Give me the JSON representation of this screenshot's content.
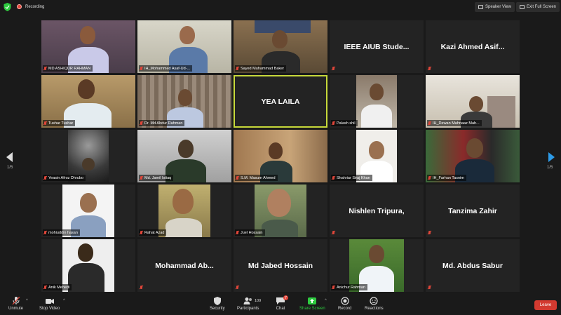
{
  "topbar": {
    "recording_label": "Recording",
    "speaker_view_label": "Speaker View",
    "exit_fullscreen_label": "Exit Full Screen"
  },
  "nav": {
    "left_page": "1/5",
    "right_page": "1/5"
  },
  "participants": [
    {
      "name": "MD ASHIQUR RAHMAN",
      "video": true
    },
    {
      "name": "IH_Mohammed Asaf-Ud-...",
      "video": true
    },
    {
      "name": "Sayed Muhammad Baker",
      "video": true
    },
    {
      "name": "IEEE AIUB Stude...",
      "video": false
    },
    {
      "name": "Kazi Ahmed Asif...",
      "video": false
    },
    {
      "name": "Tushar Tushar",
      "video": true
    },
    {
      "name": "Dr. Md Abdur Rahman",
      "video": true
    },
    {
      "name": "YEA LAILA",
      "video": false,
      "active": true
    },
    {
      "name": "Palash shil",
      "video": true
    },
    {
      "name": "IH_Dewan Mahnaaz Mah...",
      "video": true
    },
    {
      "name": "Yeasin Afroz Dhrubo",
      "video": true
    },
    {
      "name": "Md. Jamil Istiaq",
      "video": true
    },
    {
      "name": "S.M. Masum Ahmed",
      "video": true
    },
    {
      "name": "Shahriar Siraj Khan",
      "video": true
    },
    {
      "name": "IH_Farhan Tasnim",
      "video": true
    },
    {
      "name": "mohiuddin hasan",
      "video": true
    },
    {
      "name": "Rahat Azad",
      "video": true
    },
    {
      "name": "Juel Hossain",
      "video": true
    },
    {
      "name": "Nishlen  Tripura,",
      "video": false
    },
    {
      "name": "Tanzima Zahir",
      "video": false
    },
    {
      "name": "Anik Mehedi",
      "video": true
    },
    {
      "name": "Mohammad Ab...",
      "video": false
    },
    {
      "name": "Md Jabed Hossain",
      "video": false
    },
    {
      "name": "Anichur Rahman",
      "video": true
    },
    {
      "name": "Md. Abdus Sabur",
      "video": false
    }
  ],
  "toolbar": {
    "unmute": "Unmute",
    "stop_video": "Stop Video",
    "security": "Security",
    "participants": "Participants",
    "participants_count": "109",
    "chat": "Chat",
    "chat_badge": "7",
    "share_screen": "Share Screen",
    "record": "Record",
    "reactions": "Reactions",
    "leave": "Leave"
  },
  "colors": {
    "background": "#1a1a1a",
    "tile_background": "#232323",
    "active_speaker_border": "#c7d83a",
    "share_screen_green": "#2ecc40",
    "leave_red": "#d33a30",
    "mute_red": "#e0463a",
    "nav_arrow_blue": "#2d9be8"
  }
}
